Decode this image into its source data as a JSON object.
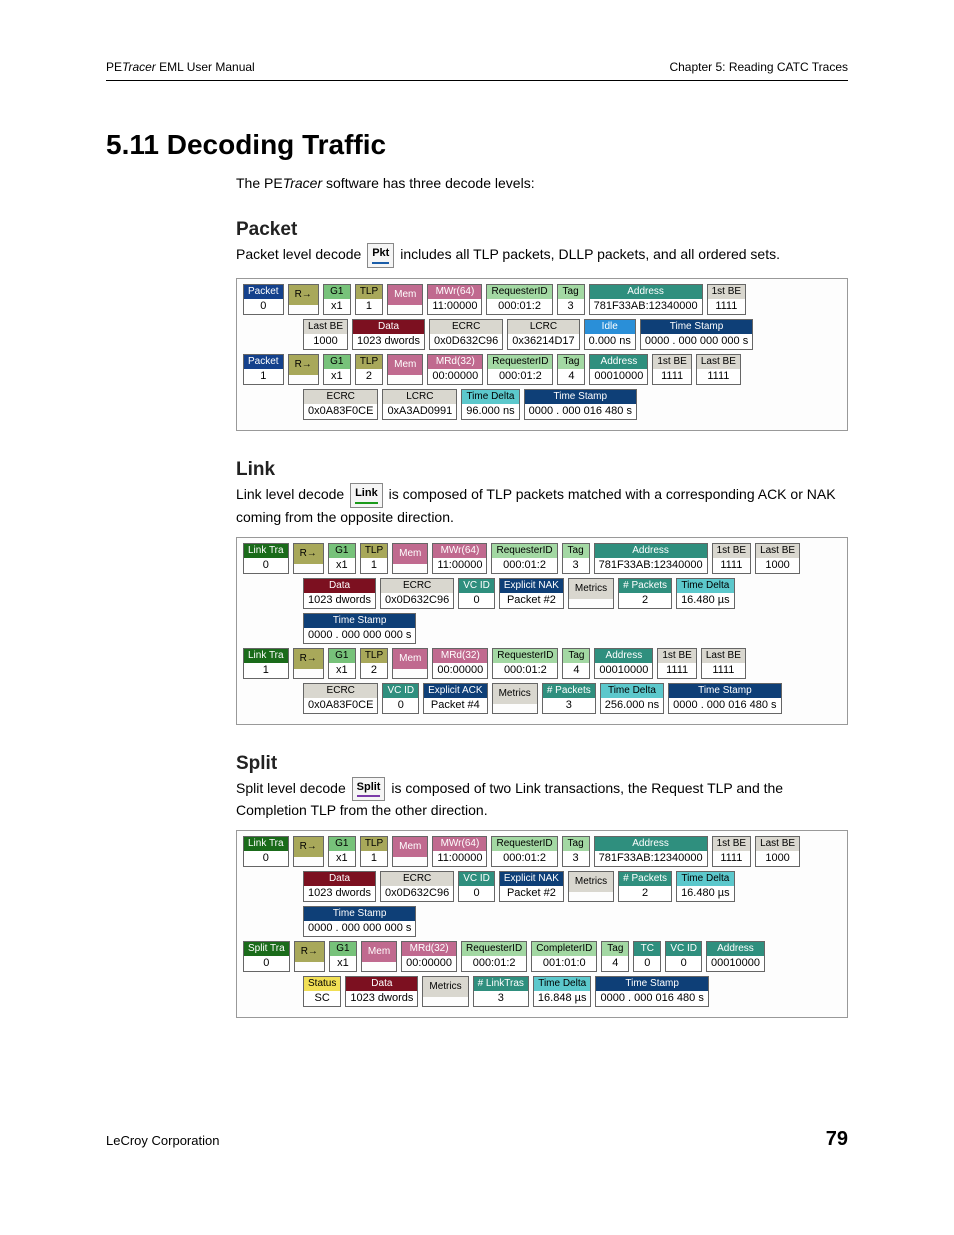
{
  "header": {
    "left_pre": "PE",
    "left_em": "Tracer",
    "left_post": " EML User Manual",
    "right": "Chapter 5: Reading CATC Traces"
  },
  "title": "5.11 Decoding Traffic",
  "intro_pre": "The PE",
  "intro_em": "Tracer",
  "intro_post": " software has three decode levels:",
  "sections": {
    "packet": {
      "heading": "Packet",
      "p1_a": "Packet level decode ",
      "btn": "Pkt",
      "p1_b": " includes all TLP packets, DLLP packets, and all ordered sets."
    },
    "link": {
      "heading": "Link",
      "p1_a": "Link level decode ",
      "btn": "Link",
      "p1_b": " is composed of TLP packets matched with a corresponding ACK or NAK coming from the opposite direction."
    },
    "split": {
      "heading": "Split",
      "p1_a": "Split level decode ",
      "btn": "Split",
      "p1_b": " is composed of two Link transactions, the Request TLP and the Completion TLP from the other direction."
    }
  },
  "cells": {
    "packet0": "Packet",
    "n0": "0",
    "packet1": "Packet",
    "n1": "1",
    "linktra": "Link Tra",
    "splittra": "Split Tra",
    "rarrow": "R→",
    "g1": "G1",
    "x1": "x1",
    "tlp": "TLP",
    "one": "1",
    "two": "2",
    "mem": "Mem",
    "mwr64": "MWr(64)",
    "mwr64v": "11:00000",
    "mrd32": "MRd(32)",
    "mrd32v": "00:00000",
    "reqid": "RequesterID",
    "reqidv": "000:01:2",
    "compid": "CompleterID",
    "compidv": "001:01:0",
    "tag": "Tag",
    "t3": "3",
    "t4": "4",
    "addr": "Address",
    "addrv1": "781F33AB:12340000",
    "addrv2": "00010000",
    "firstbe": "1st BE",
    "bev": "1111",
    "lastbe": "Last BE",
    "lastbev": "1000",
    "lastbev2": "1111",
    "lastbev3": "1000",
    "data": "Data",
    "datav": "1023   dwords",
    "ecrc": "ECRC",
    "ecrcv1": "0x0D632C96",
    "ecrcv2": "0x0A83F0CE",
    "lcrc": "LCRC",
    "lcrcv1": "0x36214D17",
    "lcrcv2": "0xA3AD0991",
    "idle": "Idle",
    "idlev": "0.000 ns",
    "tstamp": "Time Stamp",
    "tstampv0": "0000 . 000 000 000 s",
    "tstampv1": "0000 . 000 016 480 s",
    "tdelta": "Time Delta",
    "tdeltav1": "96.000 ns",
    "tdeltav2": "16.480 µs",
    "tdeltav3": "256.000 ns",
    "tdeltav4": "16.848 µs",
    "vcid": "VC ID",
    "vcidv": "0",
    "expnak": "Explicit NAK",
    "expnakv": "Packet #2",
    "expack": "Explicit ACK",
    "expackv": "Packet #4",
    "metrics": "Metrics",
    "npkts": "# Packets",
    "npktsv2": "2",
    "npktsv3": "3",
    "nlinktras": "# LinkTras",
    "nlinktrasv": "3",
    "status": "Status",
    "statusv": "SC",
    "tc": "TC",
    "tcv": "0"
  },
  "footer": {
    "left": "LeCroy Corporation",
    "page": "79"
  }
}
